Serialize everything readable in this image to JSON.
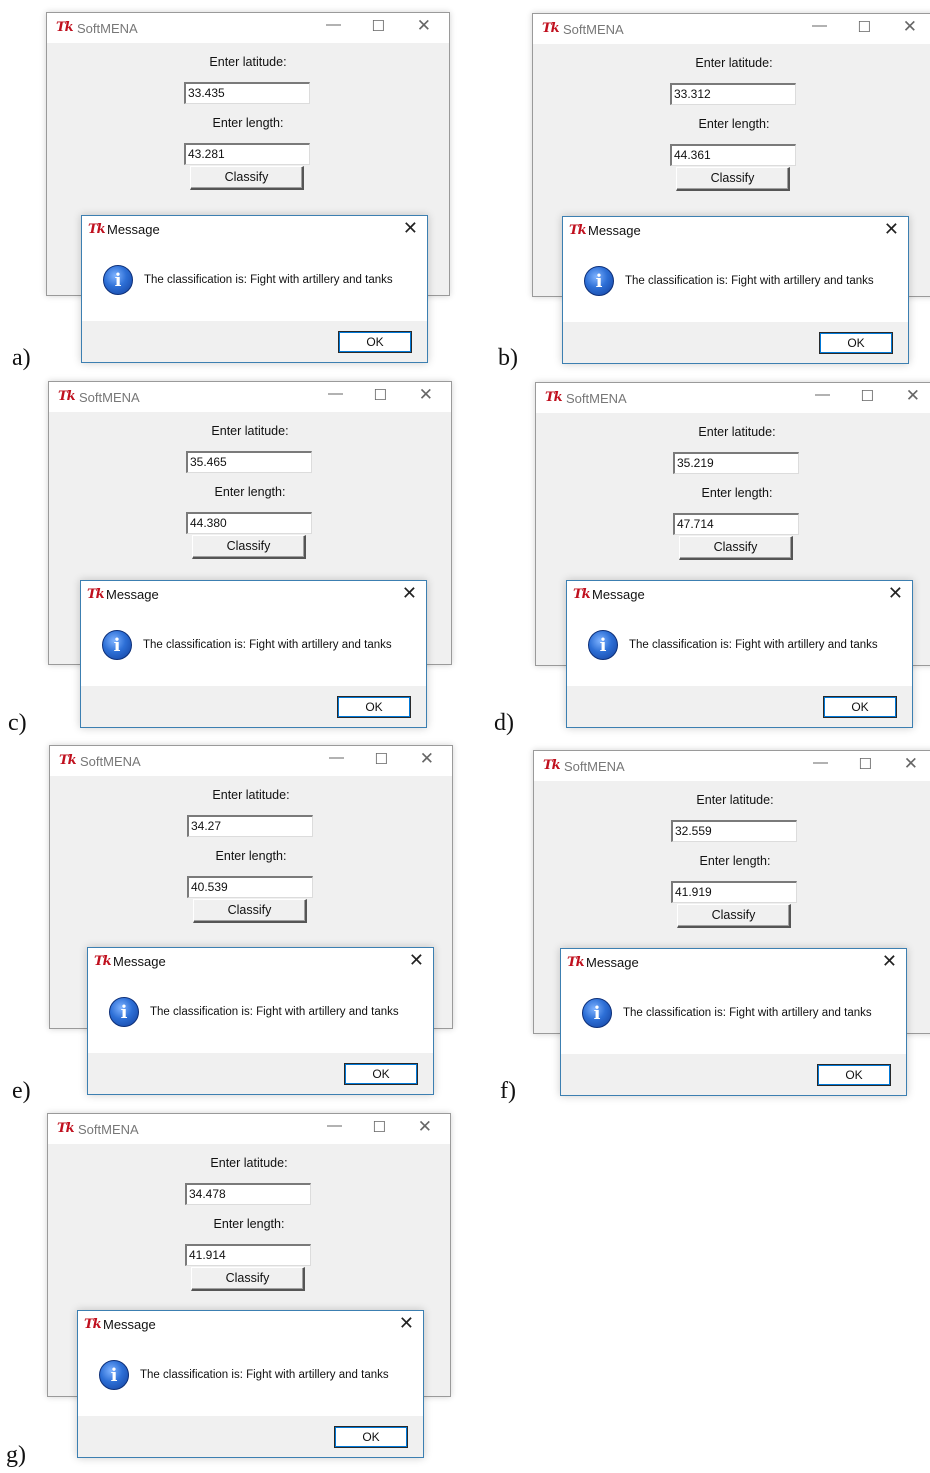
{
  "app": {
    "title": "SoftMENA",
    "tk_icon": "Tk",
    "min_glyph": "—",
    "max_glyph": "☐",
    "close_glyph": "✕",
    "latitude_label": "Enter latitude:",
    "length_label": "Enter length:",
    "classify_label": "Classify"
  },
  "dialog": {
    "title": "Message",
    "close_glyph": "✕",
    "info_icon": "i",
    "message": "The classification is: Fight with artillery and tanks",
    "ok_label": "OK"
  },
  "panels": [
    {
      "label": "a)",
      "latitude": "33.435",
      "length": "43.281"
    },
    {
      "label": "b)",
      "latitude": "33.312",
      "length": "44.361"
    },
    {
      "label": "c)",
      "latitude": "35.465",
      "length": "44.380"
    },
    {
      "label": "d)",
      "latitude": "35.219",
      "length": "47.714"
    },
    {
      "label": "e)",
      "latitude": "34.27",
      "length": "40.539"
    },
    {
      "label": "f)",
      "latitude": "32.559",
      "length": "41.919"
    },
    {
      "label": "g)",
      "latitude": "34.478",
      "length": "41.914"
    }
  ]
}
